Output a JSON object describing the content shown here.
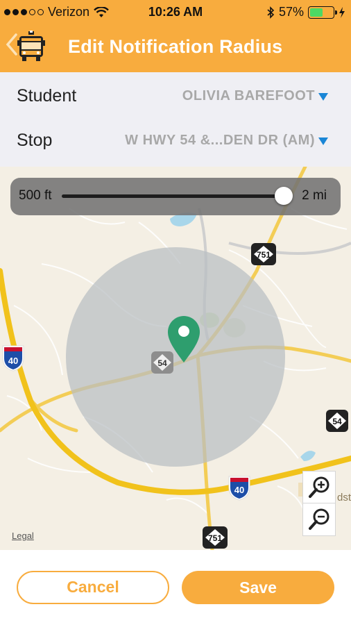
{
  "status_bar": {
    "carrier": "Verizon",
    "signal_bars_filled": 3,
    "signal_bars_total": 5,
    "time": "10:26 AM",
    "battery_percent": "57%",
    "battery_level": 0.57,
    "icons": [
      "wifi-icon",
      "bluetooth-icon",
      "battery-icon",
      "charging-bolt-icon"
    ]
  },
  "nav": {
    "title": "Edit Notification Radius",
    "back_icon": "chevron-left-icon",
    "logo_icon": "school-bus-icon"
  },
  "selectors": {
    "student": {
      "label": "Student",
      "value": "OLIVIA BAREFOOT"
    },
    "stop": {
      "label": "Stop",
      "value": "W HWY 54 &...DEN DR (AM)"
    }
  },
  "map": {
    "slider": {
      "min_label": "500 ft",
      "max_label": "2 mi",
      "value_fraction": 1.0
    },
    "route_shields": [
      {
        "network": "NC",
        "number": "751"
      },
      {
        "network": "NC",
        "number": "54"
      },
      {
        "network": "I",
        "number": "40"
      },
      {
        "network": "NC",
        "number": "54"
      },
      {
        "network": "I",
        "number": "40"
      },
      {
        "network": "NC",
        "number": "751"
      }
    ],
    "partial_place_label": "dst",
    "legal_link": "Legal",
    "zoom_in_icon": "zoom-in-icon",
    "zoom_out_icon": "zoom-out-icon",
    "pin_color": "#2e9e6e",
    "radius_color": "#b9bec2"
  },
  "buttons": {
    "cancel": "Cancel",
    "save": "Save"
  },
  "colors": {
    "brand": "#f8ac3e",
    "dropdown_arrow": "#1a86d6",
    "value_text": "#a8a8a8"
  }
}
